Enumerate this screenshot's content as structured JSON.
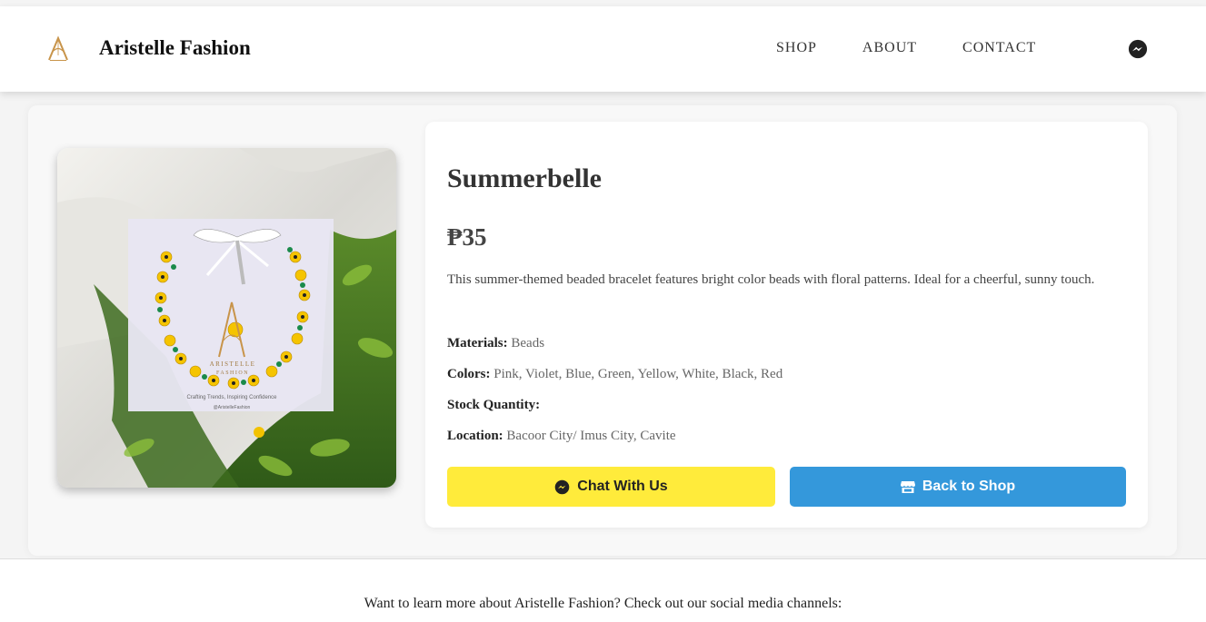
{
  "header": {
    "brand": "Aristelle Fashion",
    "nav": [
      "SHOP",
      "ABOUT",
      "CONTACT"
    ],
    "messenger_icon": "messenger-icon"
  },
  "product": {
    "title": "Summerbelle",
    "price": "₱35",
    "description": "This summer-themed beaded bracelet features bright color beads with floral patterns. Ideal for a cheerful, sunny touch.",
    "specs": {
      "materials_label": "Materials:",
      "materials": "Beads",
      "colors_label": "Colors:",
      "colors": "Pink, Violet, Blue, Green, Yellow, White, Black, Red",
      "stock_label": "Stock Quantity:",
      "stock": "",
      "location_label": "Location:",
      "location": "Bacoor City/ Imus City, Cavite"
    },
    "image_logo": {
      "brand": "ARISTELLE",
      "sub": "FASHION",
      "tagline": "Crafting Trends, Inspiring Confidence",
      "handle": "@AristelleFashion"
    }
  },
  "actions": {
    "chat_label": "Chat With Us",
    "back_label": "Back to Shop"
  },
  "footer": {
    "text": "Want to learn more about Aristelle Fashion? Check out our social media channels:"
  },
  "colors": {
    "chat_button": "#ffeb3b",
    "shop_button": "#3498db",
    "logo_gold": "#c8944a"
  }
}
